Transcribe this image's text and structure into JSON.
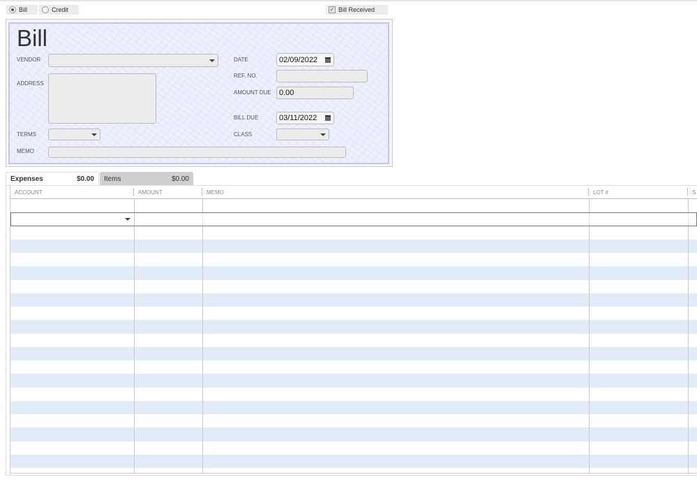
{
  "type_toggle": {
    "bill_label": "Bill",
    "credit_label": "Credit",
    "selected": "Bill"
  },
  "bill_received": {
    "label": "Bill Received",
    "checked": true
  },
  "form": {
    "title": "Bill",
    "vendor_label": "VENDOR",
    "vendor_value": "",
    "address_label": "ADDRESS",
    "address_value": "",
    "terms_label": "TERMS",
    "terms_value": "",
    "memo_label": "MEMO",
    "memo_value": "",
    "date_label": "DATE",
    "date_value": "02/09/2022",
    "ref_label": "REF. NO.",
    "ref_value": "",
    "amount_due_label": "AMOUNT DUE",
    "amount_due_value": "0.00",
    "bill_due_label": "BILL DUE",
    "bill_due_value": "03/11/2022",
    "class_label": "CLASS",
    "class_value": ""
  },
  "tabs": [
    {
      "label": "Expenses",
      "amount": "$0.00",
      "active": true
    },
    {
      "label": "Items",
      "amount": "$0.00",
      "active": false
    }
  ],
  "columns": [
    "ACCOUNT",
    "AMOUNT",
    "MEMO",
    "LOT #",
    "S"
  ],
  "colors": {
    "stripe": "#e2ecf9",
    "form_bg": "#eef0fd",
    "form_border": "#c3c6e8"
  }
}
